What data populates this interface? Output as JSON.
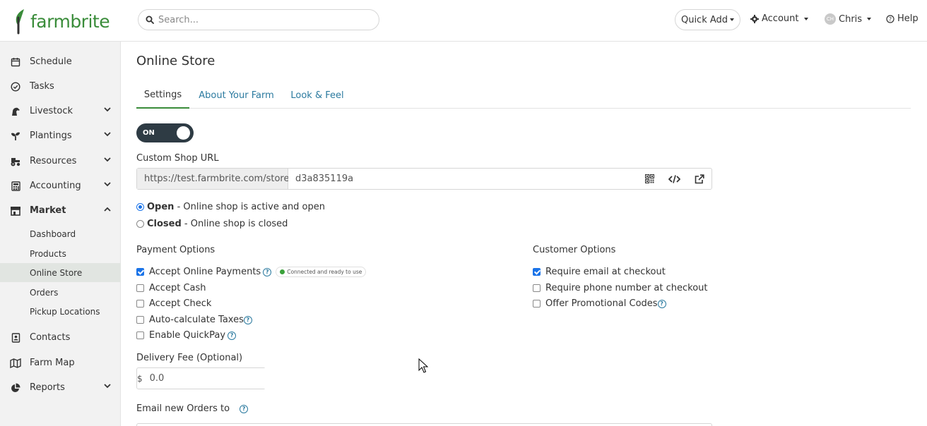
{
  "header": {
    "logo_text": "farmbrite",
    "search_placeholder": "Search...",
    "quick_add": "Quick Add",
    "account": "Account",
    "user_initials": "CH",
    "user_name": "Chris",
    "help": "Help"
  },
  "sidebar": {
    "items": [
      {
        "label": "Schedule"
      },
      {
        "label": "Tasks"
      },
      {
        "label": "Livestock"
      },
      {
        "label": "Plantings"
      },
      {
        "label": "Resources"
      },
      {
        "label": "Accounting"
      },
      {
        "label": "Market"
      },
      {
        "label": "Contacts"
      },
      {
        "label": "Farm Map"
      },
      {
        "label": "Reports"
      }
    ],
    "market_sub": [
      {
        "label": "Dashboard"
      },
      {
        "label": "Products"
      },
      {
        "label": "Online Store"
      },
      {
        "label": "Orders"
      },
      {
        "label": "Pickup Locations"
      }
    ]
  },
  "main": {
    "title": "Online Store",
    "tabs": [
      {
        "label": "Settings"
      },
      {
        "label": "About Your Farm"
      },
      {
        "label": "Look & Feel"
      }
    ],
    "toggle_label": "ON",
    "custom_url_label": "Custom Shop URL",
    "url_prefix": "https://test.farmbrite.com/store/",
    "url_value": "d3a835119a",
    "status": {
      "open_title": "Open",
      "open_desc": " - Online shop is active and open",
      "closed_title": "Closed",
      "closed_desc": " - Online shop is closed"
    },
    "payment": {
      "title": "Payment Options",
      "online_payments": "Accept Online Payments",
      "connected_badge": "Connected and ready to use",
      "cash": "Accept Cash",
      "check": "Accept Check",
      "auto_tax": "Auto-calculate Taxes",
      "quickpay": "Enable QuickPay"
    },
    "customer": {
      "title": "Customer Options",
      "require_email": "Require email at checkout",
      "require_phone": "Require phone number at checkout",
      "promo_codes": "Offer Promotional Codes"
    },
    "delivery_fee_label": "Delivery Fee (Optional)",
    "currency_symbol": "$",
    "delivery_fee_value": "0.0",
    "email_orders_label": "Email new Orders to"
  },
  "colors": {
    "brand_green": "#3a8c3a",
    "link_blue": "#2b7a9f",
    "toggle_dark": "#2e3b44",
    "check_blue": "#1a73e8"
  }
}
